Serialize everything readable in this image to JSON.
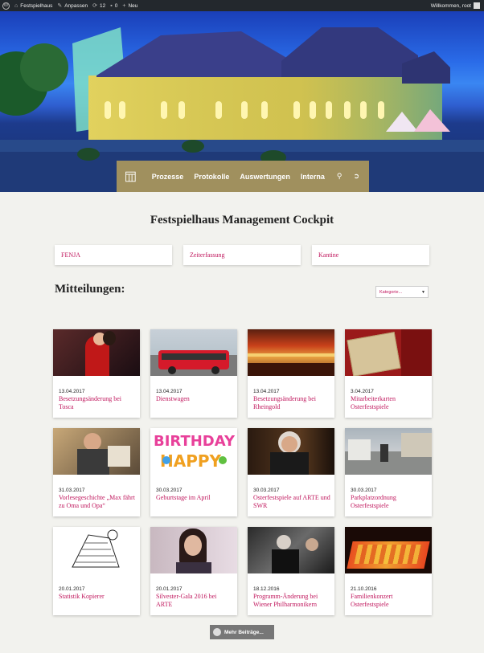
{
  "adminbar": {
    "site": "Festspielhaus",
    "customize": "Anpassen",
    "updates": "12",
    "comments": "0",
    "new": "Neu",
    "welcome": "Willkommen, root"
  },
  "nav": {
    "items": [
      "Prozesse",
      "Protokolle",
      "Auswertungen",
      "Interna"
    ],
    "search_icon": "search-icon",
    "logout_icon": "logout-icon"
  },
  "page": {
    "title": "Festspielhaus Management Cockpit",
    "quicklinks": [
      "FENJA",
      "Zeiterfassung",
      "Kantine"
    ],
    "news_heading": "Mitteilungen:",
    "category_select": "Kategorie..."
  },
  "posts": [
    {
      "date": "13.04.2017",
      "title": "Besetzungsänderung bei Tosca"
    },
    {
      "date": "13.04.2017",
      "title": "Dienstwagen"
    },
    {
      "date": "13.04.2017",
      "title": "Besetzungsänderung bei Rheingold"
    },
    {
      "date": "3.04.2017",
      "title": "Mitarbeiterkarten Osterfestspiele"
    },
    {
      "date": "31.03.2017",
      "title": "Vorlesegeschichte „Max fährt zu Oma und Opa“"
    },
    {
      "date": "30.03.2017",
      "title": "Geburtstage im April"
    },
    {
      "date": "30.03.2017",
      "title": "Osterfestspiele auf ARTE und SWR"
    },
    {
      "date": "30.03.2017",
      "title": "Parkplatzordnung Osterfestspiele"
    },
    {
      "date": "20.01.2017",
      "title": "Statistik Kopierer"
    },
    {
      "date": "20.01.2017",
      "title": "Silvester-Gala 2016 bei ARTE"
    },
    {
      "date": "18.12.2016",
      "title": "Programm-Änderung bei Wiener Philharmonikern"
    },
    {
      "date": "21.10.2016",
      "title": "Familienkonzert Osterfestspiele"
    }
  ],
  "more_button": "Mehr Beiträge...",
  "colors": {
    "accent": "#c0175d",
    "nav": "#a0905e",
    "adminbar": "#23282d"
  }
}
